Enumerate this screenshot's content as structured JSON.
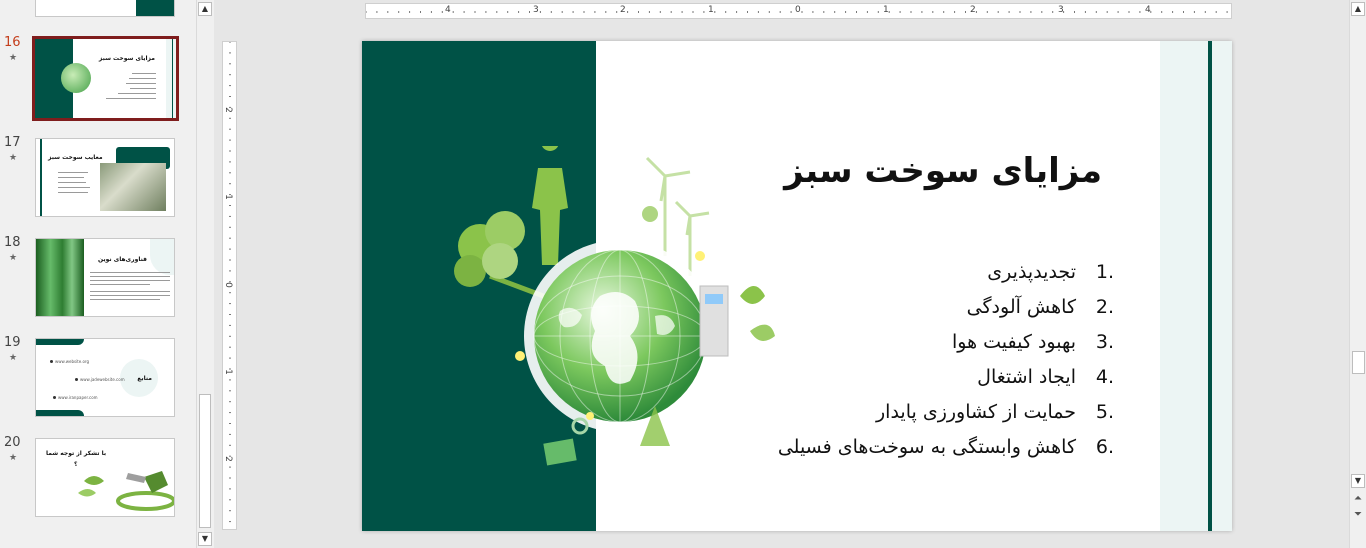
{
  "thumbnails": [
    {
      "number": "",
      "starred": false,
      "selected": false
    },
    {
      "number": "16",
      "starred": true,
      "selected": true,
      "title": "مزایای سوخت سبز"
    },
    {
      "number": "17",
      "starred": true,
      "selected": false,
      "title": "معایب سوخت سبز"
    },
    {
      "number": "18",
      "starred": true,
      "selected": false,
      "title": "فناوری‌های نوین"
    },
    {
      "number": "19",
      "starred": true,
      "selected": false,
      "title": "منابع",
      "links": [
        "www.website.org",
        "www.jadewebsite.com",
        "www.iranpaper.com"
      ]
    },
    {
      "number": "20",
      "starred": true,
      "selected": false,
      "title": "با تشکر از توجه شما",
      "subtitle": "؟"
    }
  ],
  "star_glyph": "★",
  "ruler": {
    "horizontal": [
      "4",
      "3",
      "2",
      "1",
      "0",
      "1",
      "2",
      "3",
      "4"
    ],
    "vertical": [
      "2",
      "1",
      "0",
      "1",
      "2"
    ]
  },
  "slide": {
    "title": "مزایای سوخت سبز",
    "items": [
      {
        "num": "1.",
        "text": "تجدیدپذیری"
      },
      {
        "num": "2.",
        "text": "کاهش آلودگی"
      },
      {
        "num": "3.",
        "text": "بهبود کیفیت هوا"
      },
      {
        "num": "4.",
        "text": "ایجاد اشتغال"
      },
      {
        "num": "5.",
        "text": "حمایت از کشاورزی پایدار"
      },
      {
        "num": "6.",
        "text": "کاهش وابستگی به سوخت‌های فسیلی"
      }
    ]
  },
  "colors": {
    "brand_green": "#005246",
    "light_panel": "#ecf5f4",
    "selected_border": "#7f1d1d",
    "slide_number_active": "#c43e1c",
    "earth_green": "#4caf50"
  },
  "scroll": {
    "up_glyph": "▲",
    "down_glyph": "▼",
    "prev_slide_glyph": "⏶",
    "next_slide_glyph": "⏷"
  }
}
